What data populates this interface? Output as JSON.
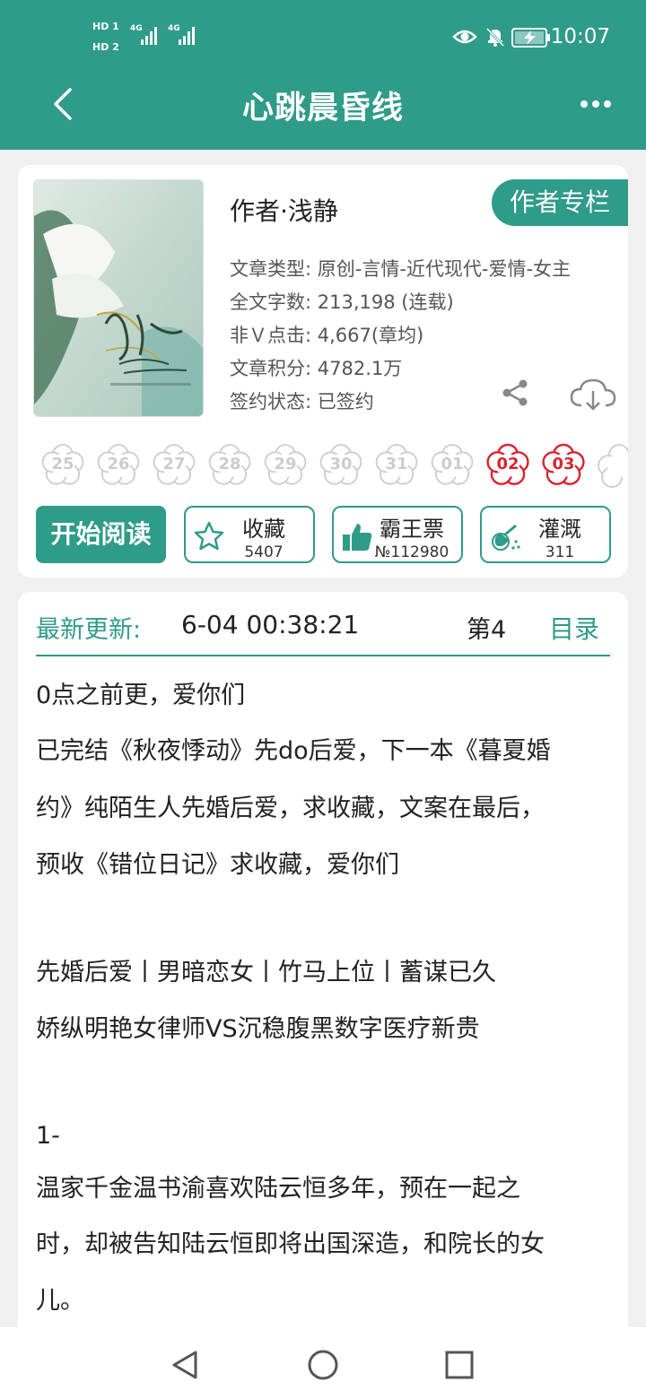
{
  "status_bar": {
    "hd1": "HD 1",
    "hd2": "HD 2",
    "net1": "4G",
    "net2": "4G",
    "time": "10:07"
  },
  "nav": {
    "title": "心跳晨昏线"
  },
  "book": {
    "author": "作者·浅静",
    "author_column_button": "作者专栏",
    "type": "文章类型: 原创-言情-近代现代-爱情-女主",
    "word_count": "全文字数: 213,198 (连载)",
    "clicks": "非Ｖ点击: 4,667(章均)",
    "score": "文章积分: 4782.1万",
    "sign_status": "签约状态: 已签约"
  },
  "flowers": [
    {
      "label": "25",
      "active": false
    },
    {
      "label": "26",
      "active": false
    },
    {
      "label": "27",
      "active": false
    },
    {
      "label": "28",
      "active": false
    },
    {
      "label": "29",
      "active": false
    },
    {
      "label": "30",
      "active": false
    },
    {
      "label": "31",
      "active": false
    },
    {
      "label": "01",
      "active": false
    },
    {
      "label": "02",
      "active": true
    },
    {
      "label": "03",
      "active": true
    }
  ],
  "actions": {
    "start_reading": "开始阅读",
    "favorite_label": "收藏",
    "favorite_count": "5407",
    "bawang_label": "霸王票",
    "bawang_count": "№112980",
    "irrigate_label": "灌溉",
    "irrigate_count": "311"
  },
  "update": {
    "label": "最新更新:",
    "time": "6-04 00:38:21",
    "chapter": "第4",
    "toc": "目录"
  },
  "content": {
    "lines": [
      "0点之前更，爱你们",
      "已完结《秋夜悸动》先do后爱，下一本《暮夏婚",
      "约》纯陌生人先婚后爱，求收藏，文案在最后，",
      "预收《错位日记》求收藏，爱你们",
      "先婚后爱丨男暗恋女丨竹马上位丨蓄谋已久",
      "娇纵明艳女律师VS沉稳腹黑数字医疗新贵",
      "1-",
      "温家千金温书渝喜欢陆云恒多年，预在一起之",
      "时，却被告知陆云恒即将出国深造，和院长的女",
      "儿。"
    ]
  },
  "colors": {
    "accent": "#2f9b89",
    "flower_active": "#d82430"
  }
}
